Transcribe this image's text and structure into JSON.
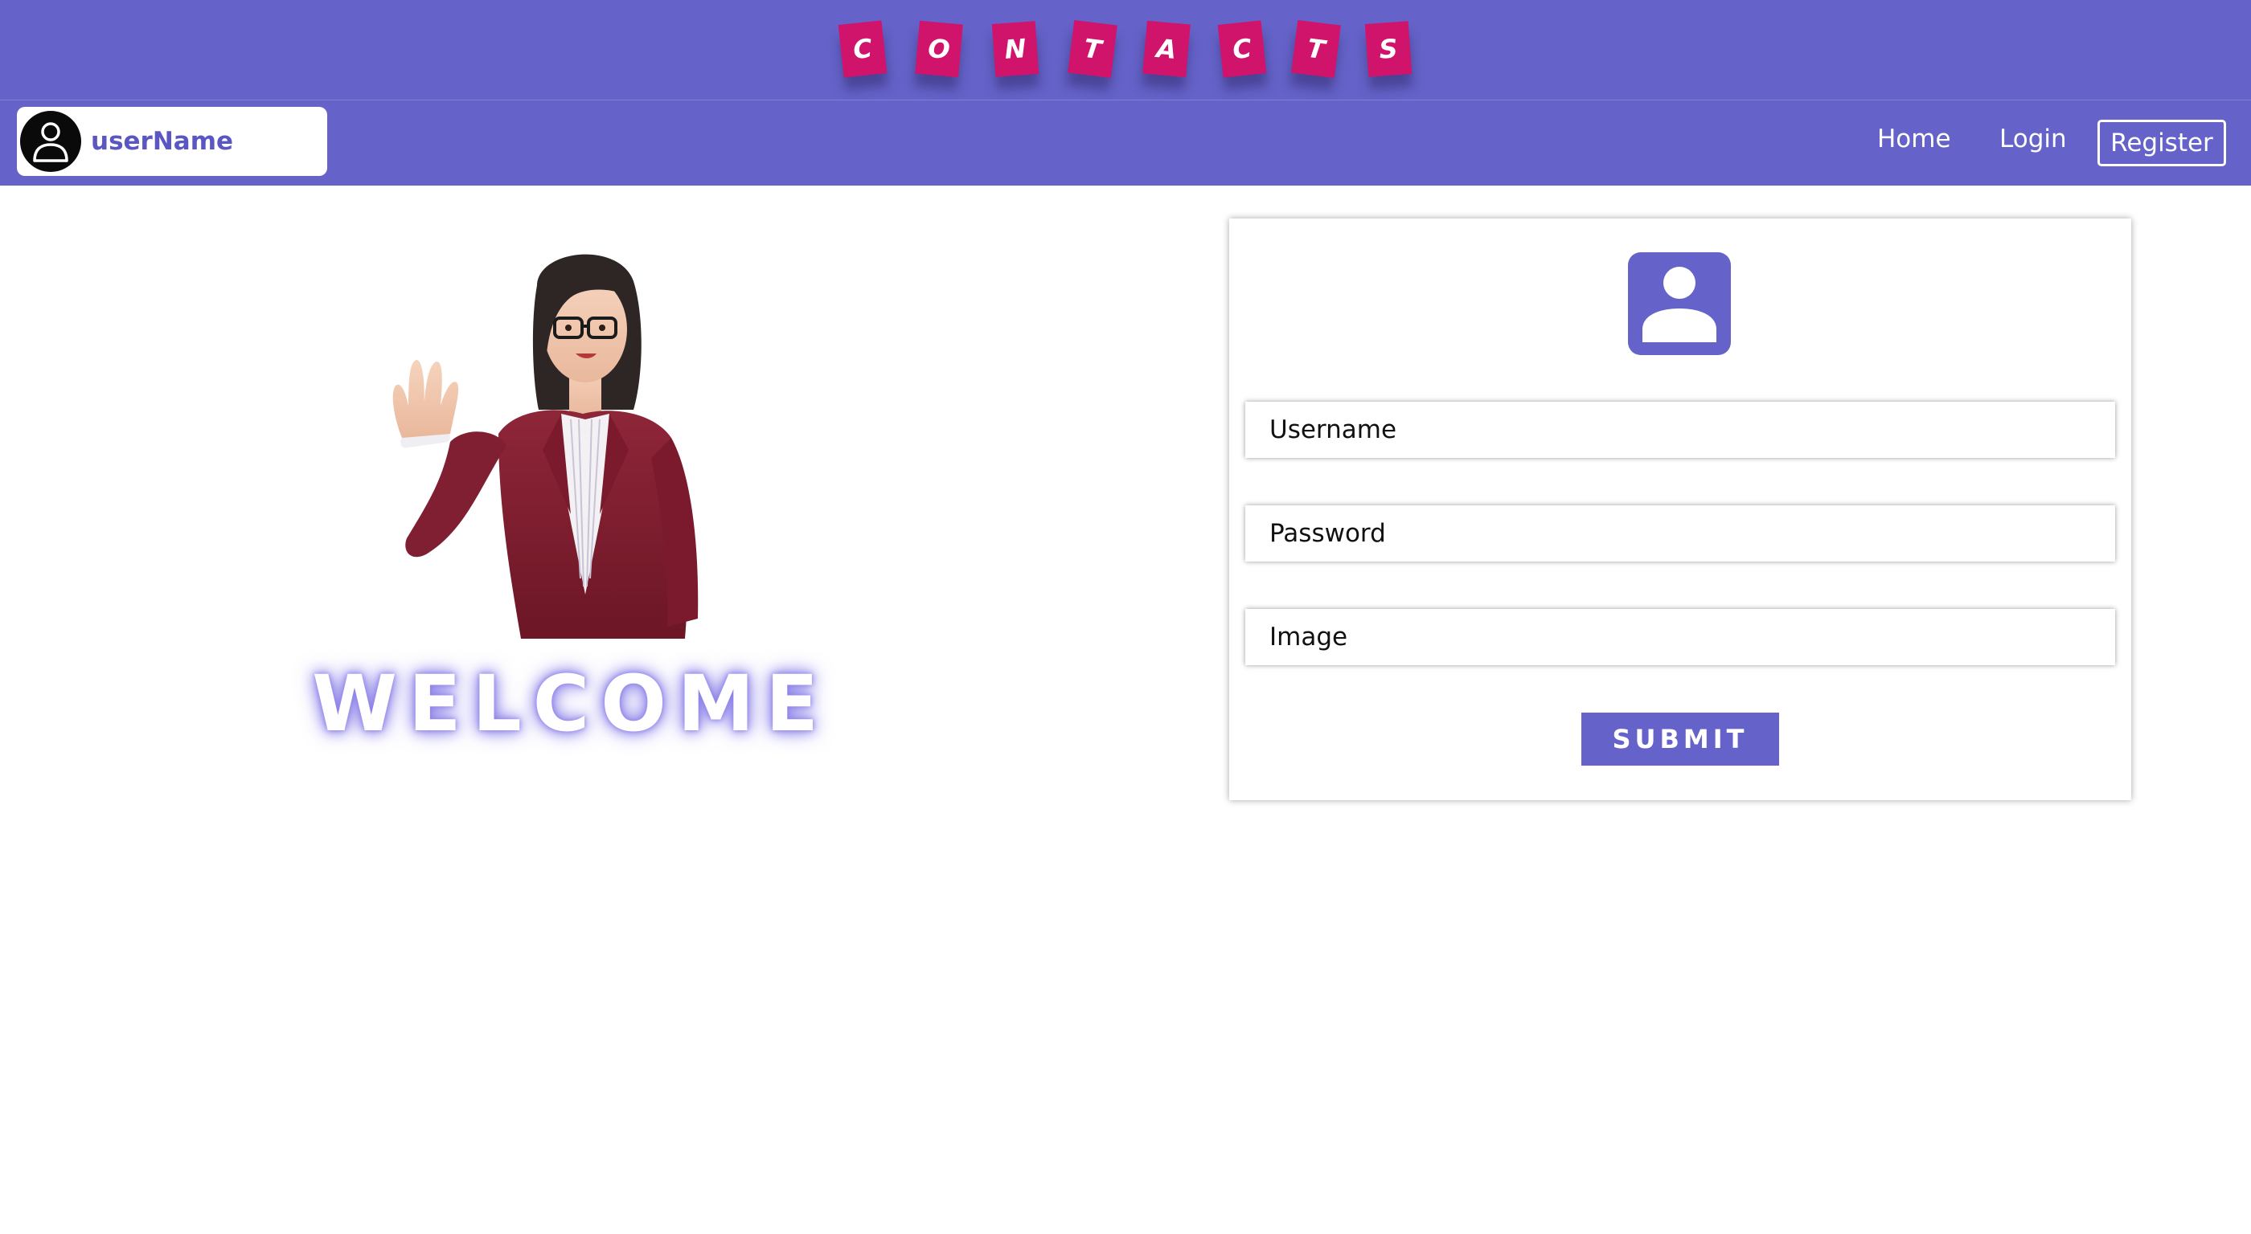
{
  "banner": {
    "letters": [
      "C",
      "O",
      "N",
      "T",
      "A",
      "C",
      "T",
      "S"
    ],
    "tile_color": "#d0146b",
    "background_color": "#6563c9"
  },
  "navbar": {
    "user_name": "userName",
    "avatar_icon": "user-outline-icon",
    "links": {
      "home": "Home",
      "login": "Login",
      "register": "Register"
    }
  },
  "welcome": {
    "heading": "WELCOME",
    "illustration": "waving-woman-3d-character"
  },
  "form": {
    "header_icon": "user-portrait-icon",
    "fields": {
      "username": "Username",
      "password": "Password",
      "image": "Image"
    },
    "submit_label": "SUBMIT",
    "accent_color": "#6563c9"
  }
}
